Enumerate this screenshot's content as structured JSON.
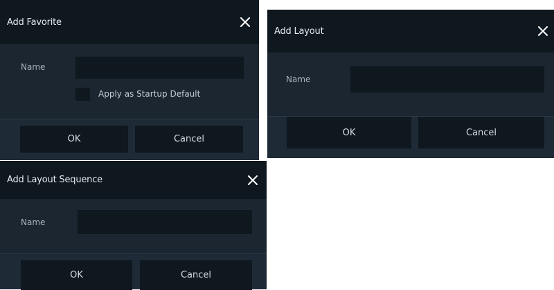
{
  "colors": {
    "dialog_body": "#1b2631",
    "dialog_header": "#0f171f",
    "input_bg": "#0f171f",
    "button_bg": "#0f171f",
    "text": "#c5ccd3"
  },
  "dialogs": {
    "favorite": {
      "title": "Add Favorite",
      "close_icon": "close-icon",
      "name_label": "Name",
      "name_value": "",
      "checkbox_label": "Apply as Startup Default",
      "checkbox_checked": false,
      "ok_label": "OK",
      "cancel_label": "Cancel"
    },
    "layout": {
      "title": "Add Layout",
      "close_icon": "close-icon",
      "name_label": "Name",
      "name_value": "",
      "ok_label": "OK",
      "cancel_label": "Cancel"
    },
    "sequence": {
      "title": "Add Layout Sequence",
      "close_icon": "close-icon",
      "name_label": "Name",
      "name_value": "",
      "ok_label": "OK",
      "cancel_label": "Cancel"
    }
  }
}
